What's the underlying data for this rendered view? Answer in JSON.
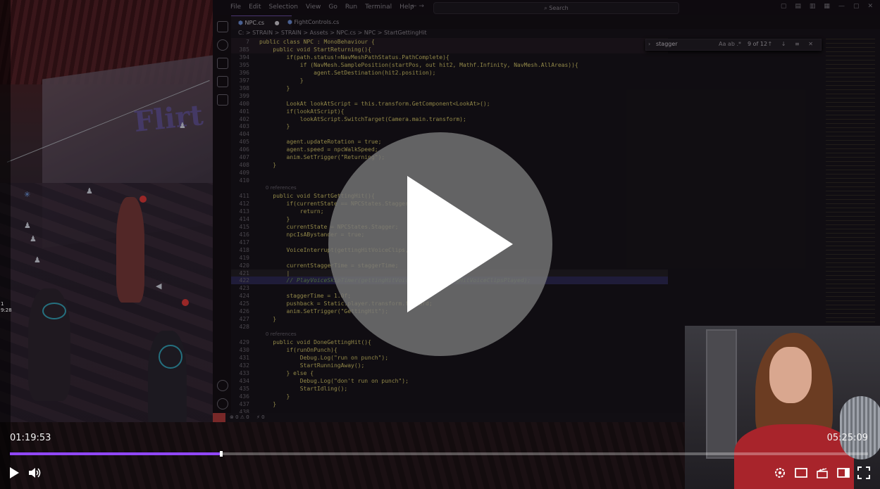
{
  "editor": {
    "menu": [
      "File",
      "Edit",
      "Selection",
      "View",
      "Go",
      "Run",
      "Terminal",
      "Help"
    ],
    "search_placeholder": "Search",
    "tabs": [
      {
        "label": "NPC.cs",
        "modified": "●"
      },
      {
        "label": "FightControls.cs"
      }
    ],
    "breadcrumb": "C: > STRAIN > STRAIN > Assets > NPC.cs > NPC > StartGettingHit",
    "find": {
      "query": "stagger",
      "options": "Aa ab .*",
      "count": "9 of 12",
      "buttons": "↑ ↓ ≡ ✕"
    },
    "status": {
      "errors": "⊗ 0 ⚠ 0",
      "warnings": "⚡ 0"
    },
    "code_lines": [
      {
        "n": "7",
        "t": "public class NPC : MonoBehaviour {",
        "cls": "sticky"
      },
      {
        "n": "385",
        "t": "    public void StartReturning(){",
        "cls": "sticky"
      },
      {
        "n": "394",
        "t": "        if(path.status!=NavMeshPathStatus.PathComplete){"
      },
      {
        "n": "395",
        "t": "            if (NavMesh.SamplePosition(startPos, out hit2, Mathf.Infinity, NavMesh.AllAreas)){"
      },
      {
        "n": "396",
        "t": "                agent.SetDestination(hit2.position);"
      },
      {
        "n": "397",
        "t": "            }"
      },
      {
        "n": "398",
        "t": "        }"
      },
      {
        "n": "399",
        "t": ""
      },
      {
        "n": "400",
        "t": "        LookAt lookAtScript = this.transform.GetComponent<LookAt>();"
      },
      {
        "n": "401",
        "t": "        if(lookAtScript){"
      },
      {
        "n": "402",
        "t": "            lookAtScript.SwitchTarget(Camera.main.transform);"
      },
      {
        "n": "403",
        "t": "        }"
      },
      {
        "n": "404",
        "t": ""
      },
      {
        "n": "405",
        "t": "        agent.updateRotation = true;"
      },
      {
        "n": "406",
        "t": "        agent.speed = npcWalkSpeed;"
      },
      {
        "n": "407",
        "t": "        anim.SetTrigger(\"Returning\");"
      },
      {
        "n": "408",
        "t": "    }"
      },
      {
        "n": "409",
        "t": ""
      },
      {
        "n": "410",
        "t": ""
      },
      {
        "n": "",
        "t": "    0 references",
        "cls": "ref"
      },
      {
        "n": "411",
        "t": "    public void StartGettingHit(){"
      },
      {
        "n": "412",
        "t": "        if(currentState == NPCStates.Stagger){"
      },
      {
        "n": "413",
        "t": "            return;"
      },
      {
        "n": "414",
        "t": "        }"
      },
      {
        "n": "415",
        "t": "        currentState = NPCStates.Stagger;"
      },
      {
        "n": "416",
        "t": "        npcIsABystander = true;"
      },
      {
        "n": "417",
        "t": ""
      },
      {
        "n": "418",
        "t": "        VoiceInterrupt(gettingHitVoiceClips, gettingHitVoiceChance);"
      },
      {
        "n": "419",
        "t": ""
      },
      {
        "n": "420",
        "t": "        currentStaggerTime = staggerTime;"
      },
      {
        "n": "421",
        "t": "        |",
        "cls": "cur"
      },
      {
        "n": "422",
        "t": "        // PlayVoiceSkipTimer(gettingHitVoiceClips, gettingHitVoiceClipsPlayed);",
        "cls": "hl"
      },
      {
        "n": "423",
        "t": ""
      },
      {
        "n": "424",
        "t": "        staggerTime = 1.0f;"
      },
      {
        "n": "425",
        "t": "        pushback = Static.player.transform.forward;"
      },
      {
        "n": "426",
        "t": "        anim.SetTrigger(\"GettingHit\");"
      },
      {
        "n": "427",
        "t": "    }"
      },
      {
        "n": "428",
        "t": ""
      },
      {
        "n": "",
        "t": "    0 references",
        "cls": "ref"
      },
      {
        "n": "429",
        "t": "    public void DoneGettingHit(){"
      },
      {
        "n": "430",
        "t": "        if(runOnPunch){"
      },
      {
        "n": "431",
        "t": "            Debug.Log(\"run on punch\");"
      },
      {
        "n": "432",
        "t": "            StartRunningAway();"
      },
      {
        "n": "433",
        "t": "        } else {"
      },
      {
        "n": "434",
        "t": "            Debug.Log(\"don't run on punch\");"
      },
      {
        "n": "435",
        "t": "            StartIdling();"
      },
      {
        "n": "436",
        "t": "        }"
      },
      {
        "n": "437",
        "t": "    }"
      },
      {
        "n": "438",
        "t": ""
      }
    ]
  },
  "player": {
    "current_time": "01:19:53",
    "total_time": "05:25:09",
    "progress_percent": 24.6,
    "accent_color": "#9147ff",
    "side_counter": "1\n9:28",
    "controls": {
      "play": "play-icon",
      "volume": "volume-icon",
      "settings": "gear-icon",
      "theatre": "theatre-mode-icon",
      "clip": "clip-icon",
      "sidebar": "sidebar-icon",
      "fullscreen": "fullscreen-icon"
    }
  }
}
